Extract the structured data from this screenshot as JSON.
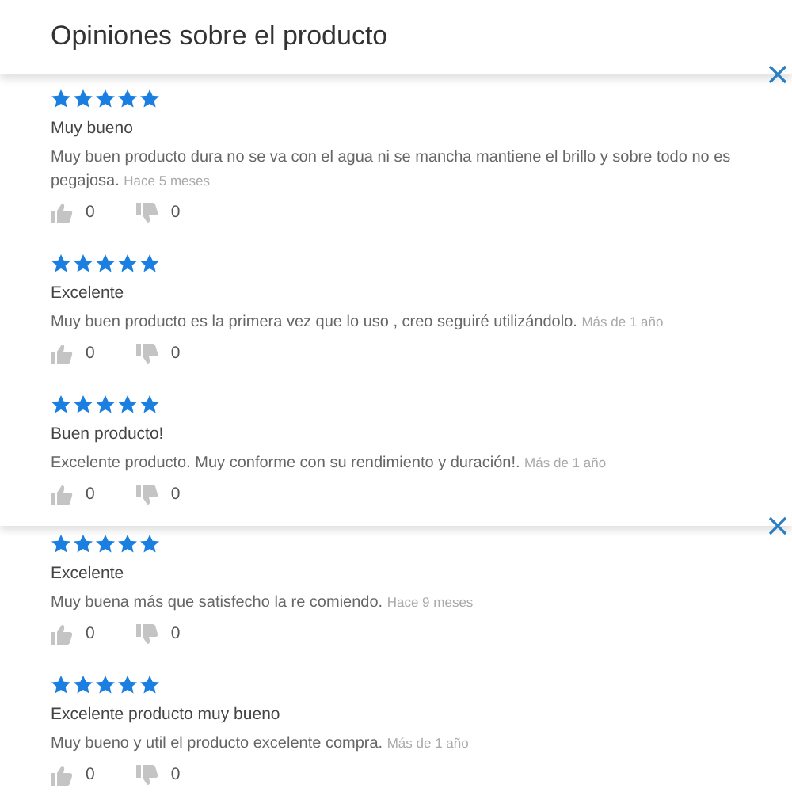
{
  "panels": [
    {
      "title": "Opiniones sobre el producto",
      "reviews": [
        {
          "stars": 5,
          "title": "Muy bueno",
          "text": "Muy buen producto dura no se va con el agua ni se mancha mantiene el brillo y sobre todo no es pegajosa.",
          "date": "Hace 5 meses",
          "likes": "0",
          "dislikes": "0"
        },
        {
          "stars": 5,
          "title": "Excelente",
          "text": "Muy buen producto es la primera vez que lo uso , creo seguiré utilizándolo.",
          "date": "Más de 1 año",
          "likes": "0",
          "dislikes": "0"
        },
        {
          "stars": 5,
          "title": "Buen producto!",
          "text": "Excelente producto. Muy conforme con su rendimiento y duración!.",
          "date": "Más de 1 año",
          "likes": "0",
          "dislikes": "0"
        }
      ]
    },
    {
      "reviews": [
        {
          "stars": 5,
          "title": "Excelente",
          "text": "Muy buena más que satisfecho la re comiendo.",
          "date": "Hace 9 meses",
          "likes": "0",
          "dislikes": "0"
        },
        {
          "stars": 5,
          "title": "Excelente producto muy bueno",
          "text": "Muy bueno y util el producto excelente compra.",
          "date": "Más de 1 año",
          "likes": "0",
          "dislikes": "0"
        }
      ]
    }
  ]
}
